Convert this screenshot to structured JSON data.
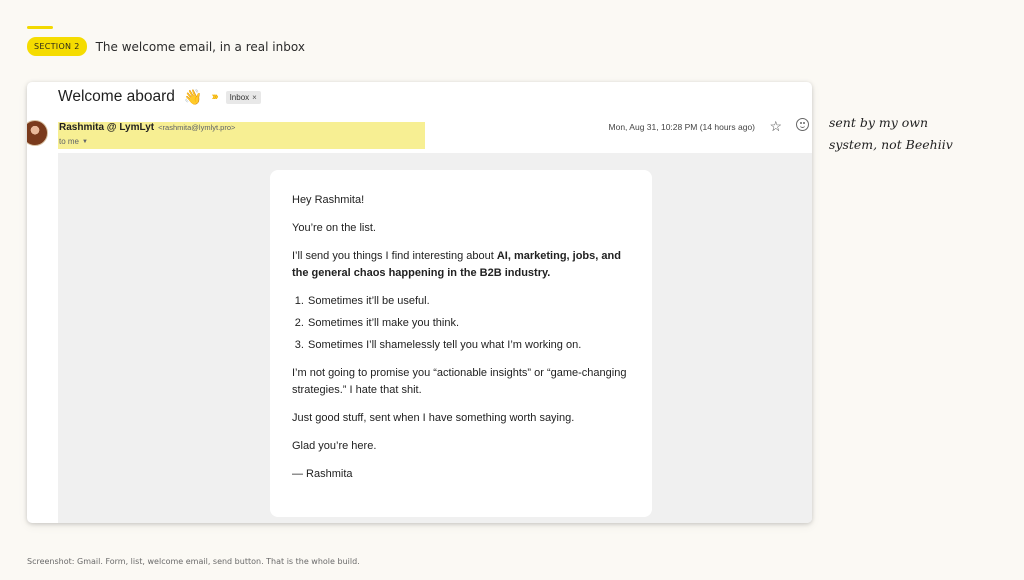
{
  "section": {
    "badge": "SECTION 2",
    "title": "The welcome email, in a real inbox"
  },
  "email": {
    "subject": "Welcome aboard",
    "subject_emoji": "👋",
    "label_chip": "Inbox",
    "chip_close": "×",
    "sender_name": "Rashmita @ LymLyt",
    "sender_email": "<rashmita@lymlyt.pro>",
    "to_line": "to me",
    "timestamp": "Mon, Aug 31, 10:28 PM (14 hours ago)",
    "body": {
      "greeting": "Hey Rashmita!",
      "line1": "You’re on the list.",
      "intro_plain": "I’ll send you things I find interesting about ",
      "intro_bold": "AI, marketing, jobs, and the general chaos happening in the B2B industry.",
      "list": [
        "Sometimes it’ll be useful.",
        "Sometimes it’ll make you think.",
        "Sometimes I’ll shamelessly tell you what I’m working on."
      ],
      "promise": "I’m not going to promise you “actionable insights” or “game-changing strategies.” I hate that shit.",
      "good_stuff": "Just good stuff, sent when I have something worth saying.",
      "glad": "Glad you’re here.",
      "signoff": "— Rashmita"
    }
  },
  "annotation": {
    "line1": "sent by my own",
    "line2": "system, not Beehiiv"
  },
  "caption": "Screenshot: Gmail. Form, list, welcome email, send button. That is the whole build.",
  "colors": {
    "accent_yellow": "#f5dc00",
    "highlight": "#f7ef93",
    "page_bg": "#fbf9f4",
    "importance": "#f4b400"
  },
  "icons": [
    "wave-emoji-icon",
    "importance-marker-icon",
    "chevron-down-icon",
    "star-icon",
    "emoji-reaction-icon",
    "avatar"
  ]
}
